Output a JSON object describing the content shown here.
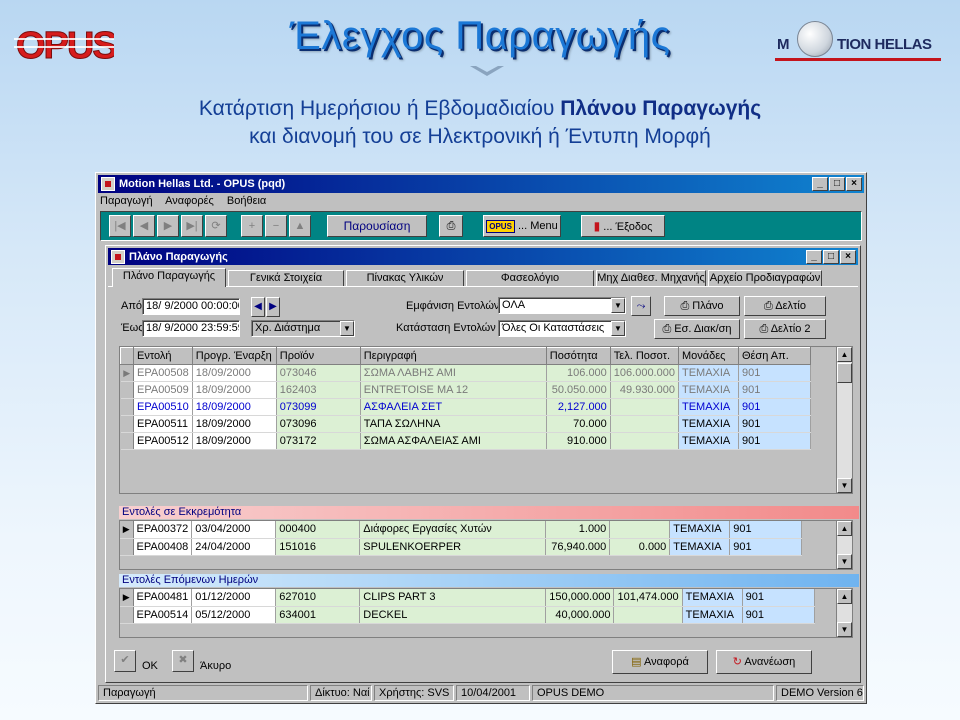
{
  "slide": {
    "title": "Έλεγχος Παραγωγής",
    "logo_left_text": "OPUS",
    "logo_right_text": "M TION HELLAS",
    "subtitle_line1_normal": "Κατάρτιση Ημερήσιου ή Εβδομαδιαίου ",
    "subtitle_line1_bold": "Πλάνου Παραγωγής",
    "subtitle_line2": "και διανομή του σε Ηλεκτρονική ή Έντυπη Μορφή"
  },
  "app": {
    "title": "Motion Hellas Ltd. - OPUS (pqd)",
    "menu": [
      "Παραγωγή",
      "Αναφορές",
      "Βοήθεια"
    ],
    "toolbar": {
      "present_label": "Παρουσίαση",
      "menu_label": "... Menu",
      "exit_label": "... Έξοδος",
      "opus_mini": "OPUS"
    },
    "status": {
      "module": "Παραγωγή",
      "network": "Δίκτυο: Ναί",
      "user": "Χρήστης: SVS",
      "date": "10/04/2001",
      "company": "OPUS DEMO",
      "version": "DEMO Version 6"
    }
  },
  "plan": {
    "title": "Πλάνο Παραγωγής",
    "tabs": [
      "Πλάνο Παραγωγής",
      "Γενικά Στοιχεία",
      "Πίνακας Υλικών",
      "Φασεολόγιο",
      "Μηχ Διαθεσ. Μηχανής",
      "Αρχείο Προδιαγραφών"
    ],
    "from_label": "Από",
    "to_label": "Έως",
    "from_value": "18/ 9/2000 00:00:00",
    "to_value": "18/ 9/2000 23:59:59",
    "interval_value": "Χρ. Διάστημα",
    "show_orders_label": "Εμφάνιση Εντολών",
    "show_orders_value": "ΟΛΑ",
    "order_status_label": "Κατάσταση Εντολών",
    "order_status_value": "Όλες Οι Καταστάσεις",
    "btn_plan": "Πλάνο",
    "btn_sheet": "Δελτίο",
    "btn_internal": "Εσ. Διακ/ση",
    "btn_sheet2": "Δελτίο 2",
    "columns": [
      "Εντολή",
      "Προγρ. Έναρξη",
      "Προϊόν",
      "Περιγραφή",
      "Ποσότητα",
      "Τελ. Ποσοτ.",
      "Μονάδες",
      "Θέση Απ."
    ],
    "rows": [
      [
        "EPA00508",
        "18/09/2000",
        "073046",
        "ΣΩΜΑ ΛΑΒΗΣ ΑΜΙ",
        "106.000",
        "106.000.000",
        "ΤΕΜΑΧΙΑ",
        "901"
      ],
      [
        "EPA00509",
        "18/09/2000",
        "162403",
        "ENTRETOISE MA 12",
        "50.050.000",
        "49.930.000",
        "ΤΕΜΑΧΙΑ",
        "901"
      ],
      [
        "EPA00510",
        "18/09/2000",
        "073099",
        "ΑΣΦΑΛΕΙΑ ΣΕΤ",
        "2,127.000",
        "",
        "ΤΕΜΑΧΙΑ",
        "901"
      ],
      [
        "EPA00511",
        "18/09/2000",
        "073096",
        "ΤΑΠΑ ΣΩΛΗΝΑ",
        "70.000",
        "",
        "ΤΕΜΑΧΙΑ",
        "901"
      ],
      [
        "EPA00512",
        "18/09/2000",
        "073172",
        "ΣΩΜΑ ΑΣΦΑΛΕΙΑΣ ΑΜΙ",
        "910.000",
        "",
        "ΤΕΜΑΧΙΑ",
        "901"
      ]
    ],
    "pending_title": "Εντολές σε Εκκρεμότητα",
    "pending_rows": [
      [
        "EPA00372",
        "03/04/2000",
        "000400",
        "Διάφορες Εργασίες Χυτών",
        "1.000",
        "",
        "ΤΕΜΑΧΙΑ",
        "901"
      ],
      [
        "EPA00408",
        "24/04/2000",
        "151016",
        "SPULENKOERPER",
        "76,940.000",
        "0.000",
        "ΤΕΜΑΧΙΑ",
        "901"
      ]
    ],
    "next_title": "Εντολές Επόμενων Ημερών",
    "next_rows": [
      [
        "EPA00481",
        "01/12/2000",
        "627010",
        "CLIPS PART 3",
        "150,000.000",
        "101,474.000",
        "ΤΕΜΑΧΙΑ",
        "901"
      ],
      [
        "EPA00514",
        "05/12/2000",
        "634001",
        "DECKEL",
        "40,000.000",
        "",
        "ΤΕΜΑΧΙΑ",
        "901"
      ]
    ],
    "ok_label": "OK",
    "cancel_label": "Άκυρο",
    "report_label": "Αναφορά",
    "refresh_label": "Ανανέωση"
  },
  "colors": {
    "title_blue": "#1c78d6",
    "title_shadow": "#0b2e70",
    "subtitle": "#143f96",
    "toolbar_teal": "#008484",
    "grid_green": "#dcf0d4",
    "grid_blue": "#c6e2ff",
    "pending_bar": "#f28a8a",
    "next_bar": "#6fb3ef",
    "brand_red": "#c4141c"
  }
}
